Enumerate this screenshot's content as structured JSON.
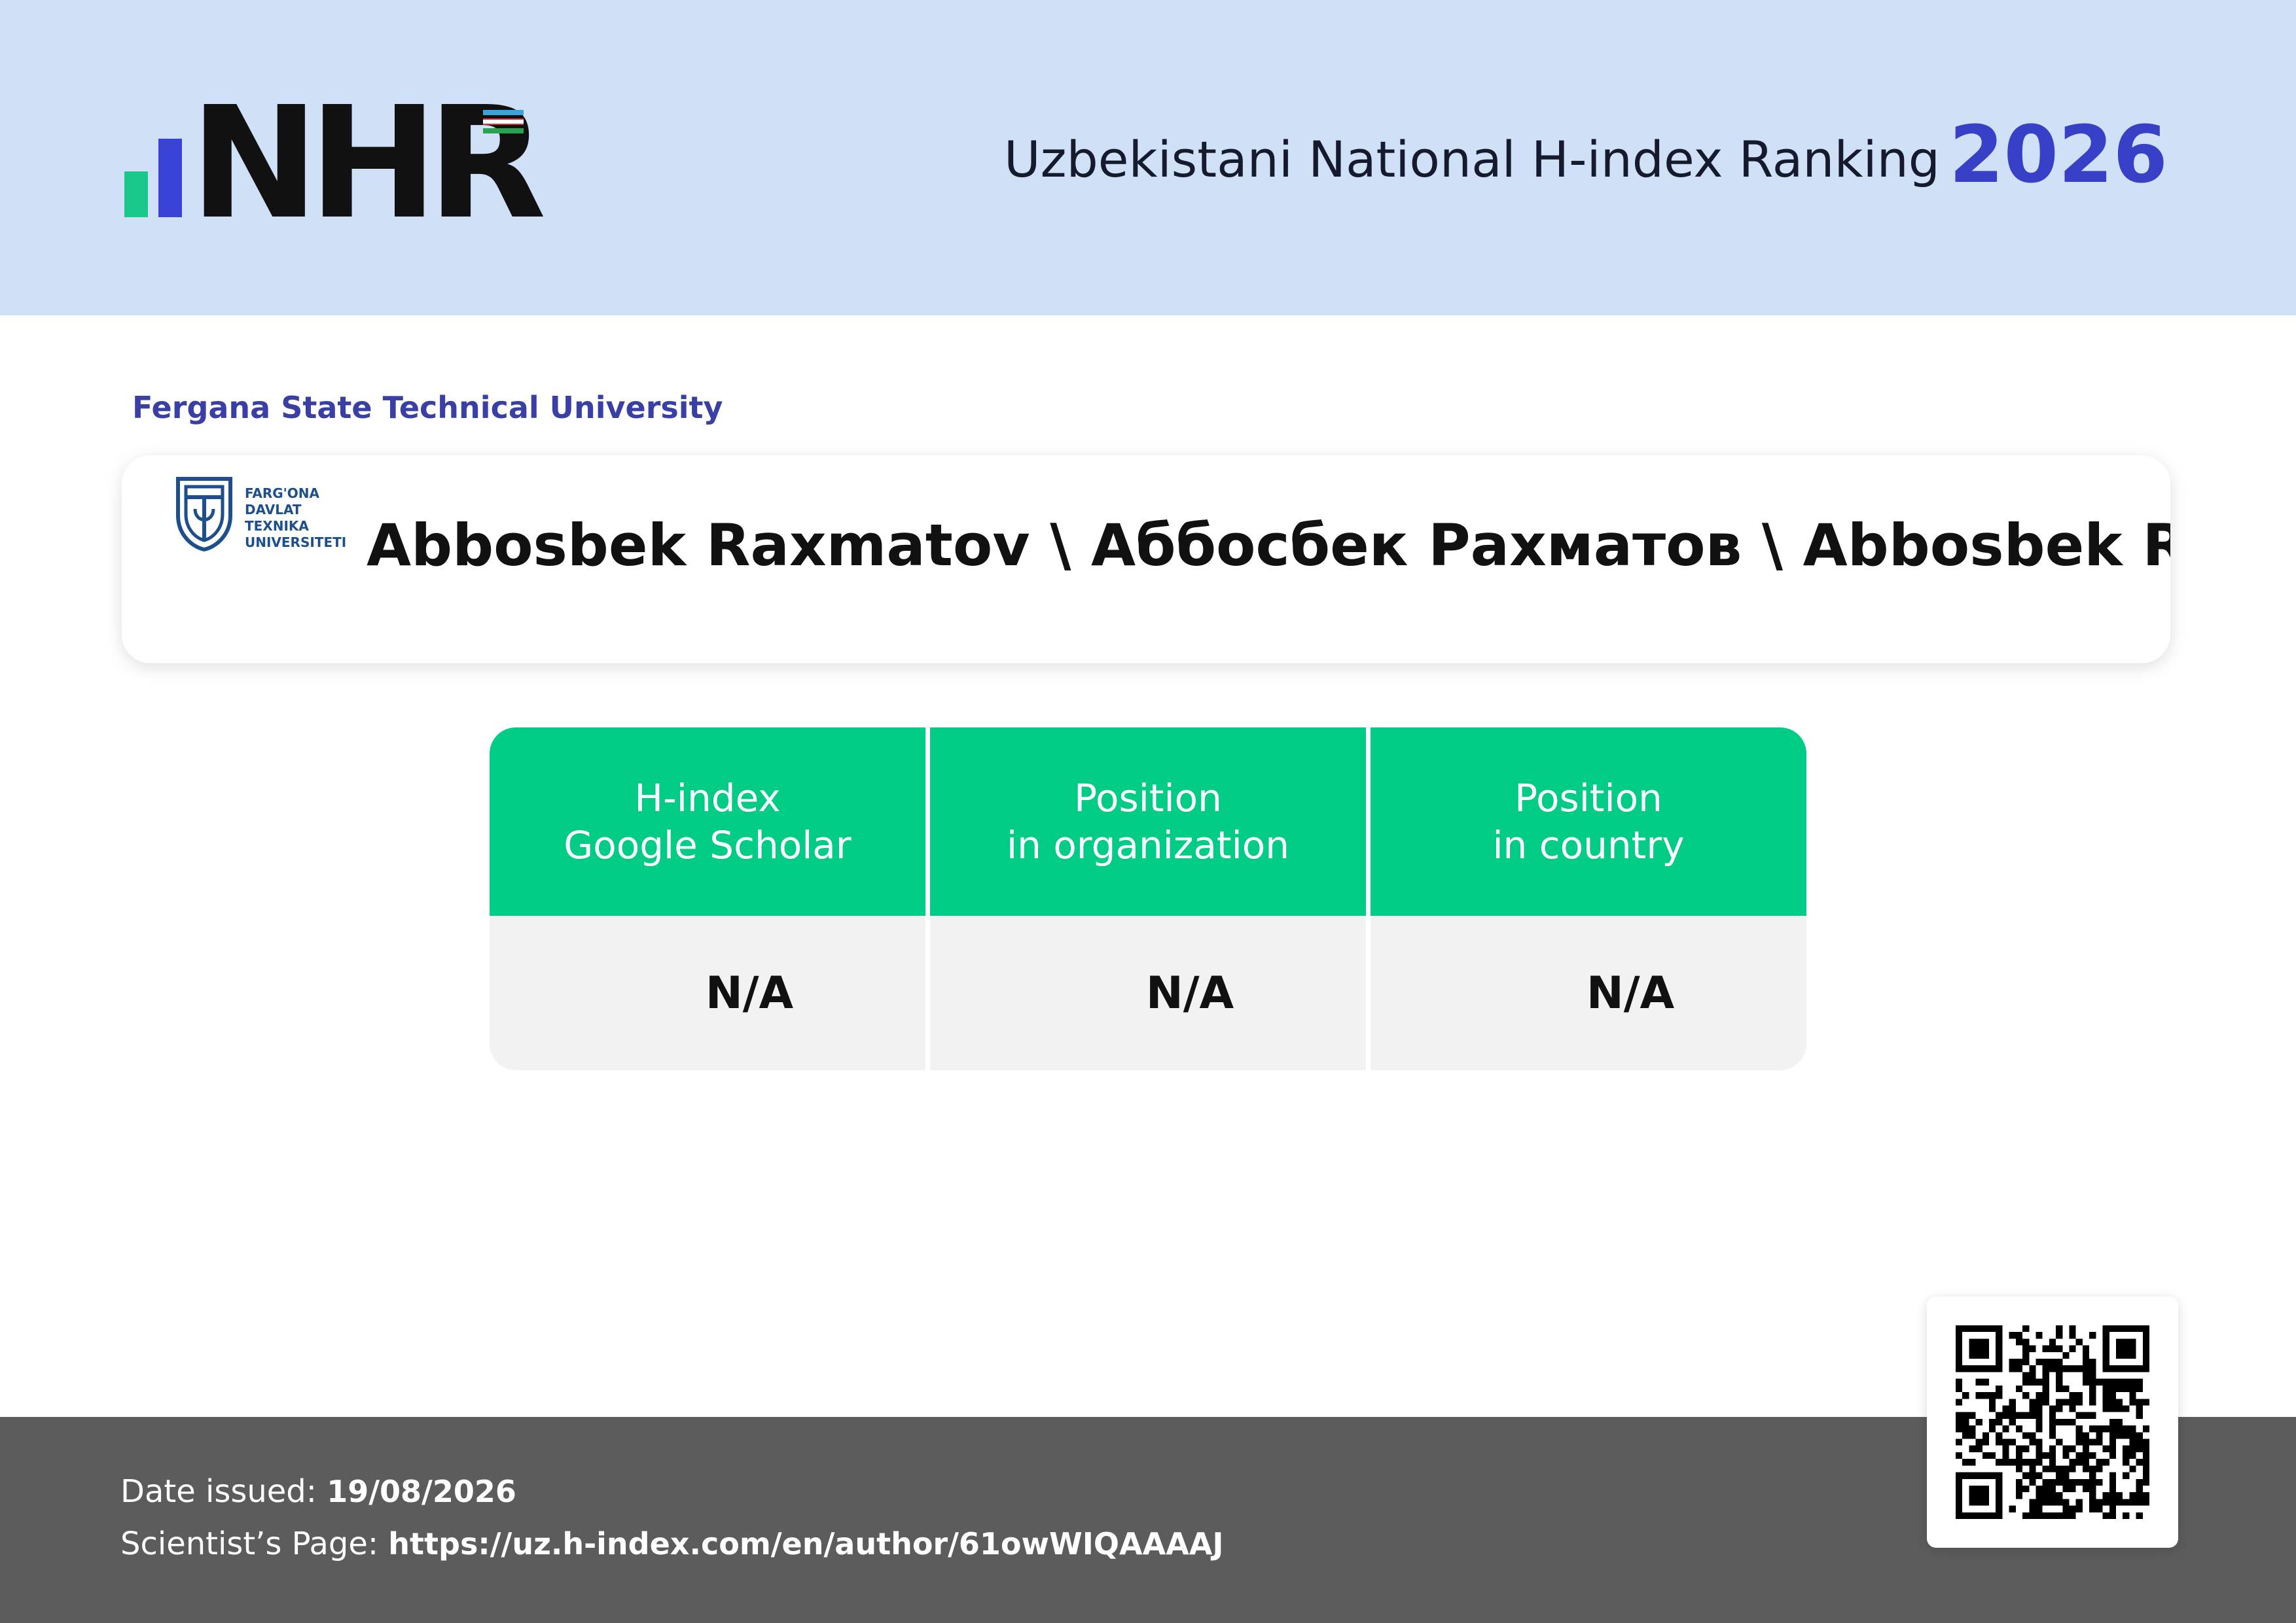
{
  "header": {
    "logo_text": "NHR",
    "title": "Uzbekistani National H-index Ranking",
    "year": "2026"
  },
  "university": {
    "name": "Fergana State Technical University",
    "logo_lines": [
      "FARG'ONA",
      "DAVLAT",
      "TEXNIKA",
      "UNIVERSITETI"
    ]
  },
  "scientist": {
    "name": "Abbosbek Raxmatov \\ Аббосбек Рахматов \\ Abbosbek Rakhmatov"
  },
  "stats": [
    {
      "label_line1": "H-index",
      "label_line2": "Google Scholar",
      "value": "N/A"
    },
    {
      "label_line1": "Position",
      "label_line2": "in organization",
      "value": "N/A"
    },
    {
      "label_line1": "Position",
      "label_line2": "in country",
      "value": "N/A"
    }
  ],
  "footer": {
    "date_label": "Date issued:",
    "date_value": "19/08/2026",
    "page_label": "Scientist’s Page:",
    "page_url": "https://uz.h-index.com/en/author/61owWIQAAAAJ"
  },
  "colors": {
    "header_bg": "#cfe0f7",
    "accent_blue": "#3940c8",
    "accent_green": "#00cc85",
    "footer_bg": "#5c5c5c"
  },
  "icons": {
    "logo": "nhr-logo",
    "university_logo": "fdtu-emblem-icon",
    "qr": "qr-code-icon"
  }
}
